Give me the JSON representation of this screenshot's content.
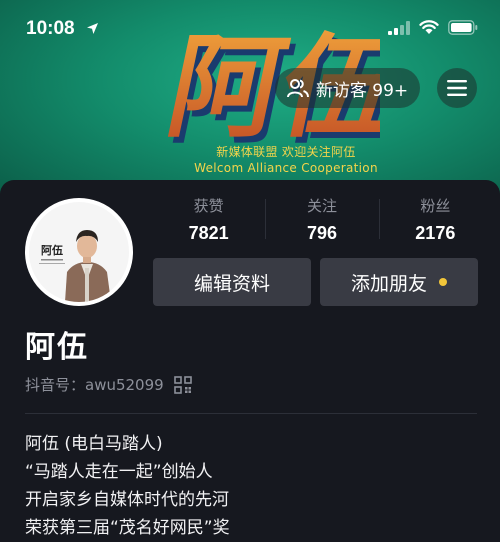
{
  "status_bar": {
    "time": "10:08"
  },
  "banner": {
    "headline": "阿伍",
    "slogan_cn": "新媒体联盟  欢迎关注阿伍",
    "slogan_en": "Welcom Alliance Cooperation",
    "accent_color": "#f3d44b"
  },
  "header": {
    "visitors_label": "新访客 99+",
    "visitors_icon": "people-icon",
    "menu_icon": "hamburger-menu-icon"
  },
  "profile": {
    "avatar_caption": "阿伍",
    "stats": [
      {
        "label": "获赞",
        "value": "7821"
      },
      {
        "label": "关注",
        "value": "796"
      },
      {
        "label": "粉丝",
        "value": "2176"
      }
    ],
    "edit_button": "编辑资料",
    "add_friend_button": "添加朋友",
    "notify_dot_color": "#f2c63a",
    "name": "阿伍",
    "douyin_id": "抖音号：awu52099",
    "qr_icon": "qr-code-icon"
  },
  "bio": {
    "lines": [
      "阿伍 (电白马踏人)",
      "“马踏人走在一起”创始人",
      "开启家乡自媒体时代的先河",
      "荣获第三届“茂名好网民”奖"
    ]
  }
}
